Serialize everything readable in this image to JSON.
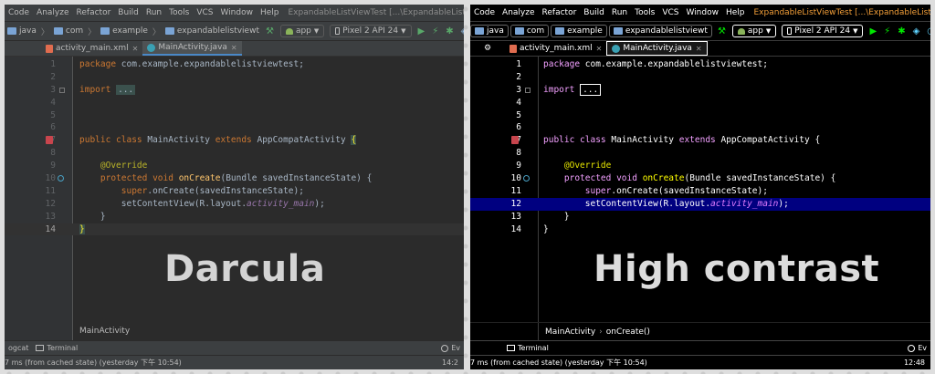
{
  "panels": [
    {
      "theme_label": "Darcula",
      "menu": [
        "Code",
        "Analyze",
        "Refactor",
        "Build",
        "Run",
        "Tools",
        "VCS",
        "Window",
        "Help"
      ],
      "window_title": "ExpandableListViewTest [...\\ExpandableListViewTest] - ...\\MainActiv",
      "breadcrumbs": [
        "java",
        "com",
        "example",
        "expandablelistviewt"
      ],
      "run_config": "app",
      "device": "Pixel 2 API 24",
      "tabs": [
        "activity_main.xml",
        "MainActivity.java"
      ],
      "lines": [
        "1",
        "2",
        "3",
        "4",
        "5",
        "6",
        "7",
        "8",
        "9",
        "10",
        "11",
        "12",
        "13",
        "14"
      ],
      "crumbbar": [
        "MainActivity"
      ],
      "tool_left": [
        "ogcat",
        "Terminal"
      ],
      "tool_right": "Ev",
      "status_text": "7 ms (from cached state) (yesterday 下午 10:54)",
      "status_right": "14:2"
    },
    {
      "theme_label": "High contrast",
      "menu": [
        "Code",
        "Analyze",
        "Refactor",
        "Build",
        "Run",
        "Tools",
        "VCS",
        "Window",
        "Help"
      ],
      "window_title": "ExpandableListViewTest [...\\ExpandableListViewTest] - ...\\MainActi",
      "breadcrumbs": [
        "java",
        "com",
        "example",
        "expandablelistviewt"
      ],
      "run_config": "app",
      "device": "Pixel 2 API 24",
      "tabs": [
        "activity_main.xml",
        "MainActivity.java"
      ],
      "lines": [
        "1",
        "2",
        "3",
        "4",
        "5",
        "6",
        "7",
        "8",
        "9",
        "10",
        "11",
        "12",
        "13",
        "14"
      ],
      "crumbbar": [
        "MainActivity",
        "onCreate()"
      ],
      "tool_left": [
        "Terminal"
      ],
      "tool_right": "Ev",
      "status_text": "7 ms (from cached state) (yesterday 下午 10:54)",
      "status_right": "12:48"
    }
  ],
  "code": {
    "package_kw": "package",
    "package_name": " com.example.expandablelistviewtest;",
    "import_kw": "import",
    "import_fold": "...",
    "public_class": "public class",
    "class_name": " MainActivity ",
    "extends_kw": "extends",
    "super_class": " AppCompatActivity ",
    "open_brace": "{",
    "annotation": "@Override",
    "protected_void": "protected void",
    "method_name": "onCreate",
    "params": "(Bundle savedInstanceState) {",
    "super_kw": "super",
    "super_call": ".onCreate(savedInstanceState);",
    "set_content": "setContentView(R.layout.",
    "layout_field": "activity_main",
    "set_content_end": ");",
    "close_method": "}",
    "close_class": "}"
  },
  "colors": {
    "darcula_bg": "#2b2b2b",
    "hc_bg": "#000000",
    "hc_selection": "#000080",
    "darcula_keyword": "#cc7832",
    "darcula_method": "#ffc66d"
  }
}
